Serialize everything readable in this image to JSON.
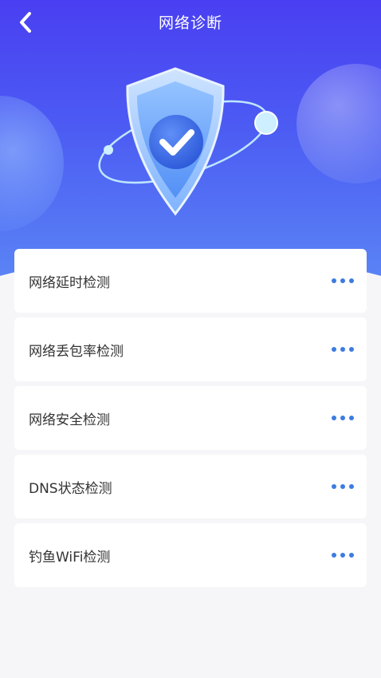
{
  "header": {
    "title": "网络诊断"
  },
  "items": [
    {
      "label": "网络延时检测"
    },
    {
      "label": "网络丢包率检测"
    },
    {
      "label": "网络安全检测"
    },
    {
      "label": "DNS状态检测"
    },
    {
      "label": "钓鱼WiFi检测"
    }
  ],
  "colors": {
    "hero_top": "#4a3ff2",
    "hero_bottom": "#5b86f5",
    "accent_dots": "#3d7be0",
    "background": "#f6f6f8"
  },
  "icons": {
    "back": "chevron-left-icon",
    "hero": "shield-check-icon",
    "more": "more-dots-icon"
  }
}
